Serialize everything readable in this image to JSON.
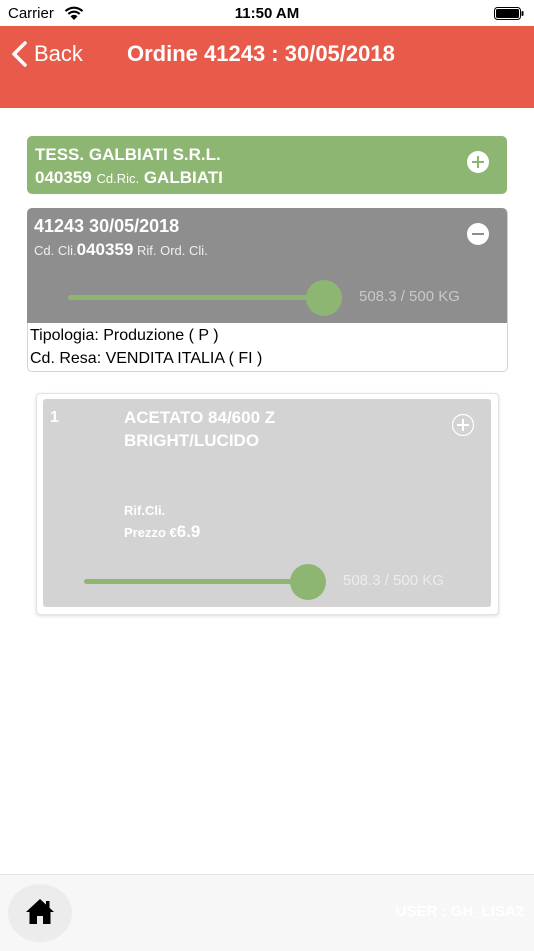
{
  "status_bar": {
    "carrier": "Carrier",
    "time": "11:50 AM"
  },
  "nav": {
    "back_label": "Back",
    "title": "Ordine 41243 : 30/05/2018"
  },
  "customer": {
    "name": "TESS. GALBIATI S.R.L.",
    "code": "040359",
    "ric_label": "Cd.Ric.",
    "ric_value": "GALBIATI"
  },
  "order": {
    "line1": "41243 30/05/2018",
    "cli_label": "Cd. Cli.",
    "cli_value": "040359",
    "rif_label": "Rif. Ord. Cli.",
    "progress_text": "508.3 / 500 KG",
    "progress_fraction": 1.0,
    "tipologia": "Tipologia: Produzione ( P )",
    "resa": "Cd. Resa: VENDITA ITALIA ( FI )"
  },
  "item": {
    "number": "1",
    "title_line1": "ACETATO 84/600 Z",
    "title_line2": "BRIGHT/LUCIDO",
    "rif_label": "Rif.Cli.",
    "prezzo_label": "Prezzo €",
    "prezzo_value": "6.9",
    "progress_text": "508.3 / 500 KG",
    "progress_fraction": 1.0
  },
  "footer": {
    "user": "USER : GH_LISA2"
  },
  "colors": {
    "nav": "#e85a4a",
    "accent_green": "#8eb673",
    "order_header": "#8e8e8e",
    "item_header": "#d3d3d3"
  },
  "icons": {
    "back": "chevron-left-icon",
    "expand": "plus-circle-icon",
    "collapse": "minus-circle-icon",
    "home": "home-icon"
  }
}
